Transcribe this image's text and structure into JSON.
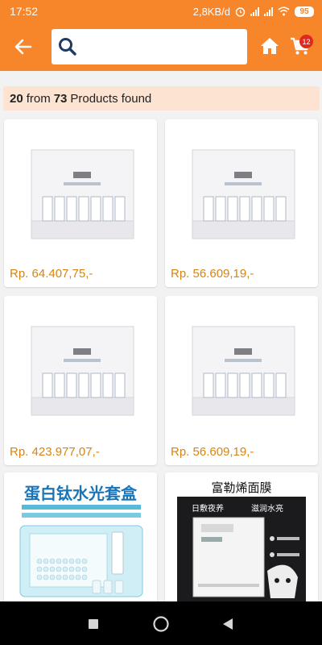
{
  "status_bar": {
    "time": "17:52",
    "network_speed": "2,8KB/d",
    "battery": "95"
  },
  "header": {
    "back_icon": "back-arrow-icon",
    "search_placeholder": "",
    "search_value": "",
    "home_icon": "home-icon",
    "cart_icon": "cart-icon",
    "cart_count": "12",
    "brand_color": "#f7862a"
  },
  "results": {
    "shown": "20",
    "from_word": "from",
    "total": "73",
    "suffix": "Products found"
  },
  "products": [
    {
      "price": "Rp. 64.407,75,-",
      "image": "white-skincare-box-set"
    },
    {
      "price": "Rp. 56.609,19,-",
      "image": "white-skincare-box-set"
    },
    {
      "price": "Rp. 423.977,07,-",
      "image": "white-skincare-box-set"
    },
    {
      "price": "Rp. 56.609,19,-",
      "image": "white-skincare-box-set"
    },
    {
      "price": "",
      "image": "blue-ampoule-gift-set",
      "caption": "蛋白钛水光套盒"
    },
    {
      "price": "",
      "image": "black-mask-package",
      "caption": "富勒烯面膜",
      "sub_left": "日敷夜养",
      "sub_right": "滋润水亮"
    }
  ],
  "nav": {
    "recent_icon": "square-recents-icon",
    "home_icon": "circle-home-icon",
    "back_icon": "triangle-back-icon"
  },
  "price_color": "#d98410"
}
